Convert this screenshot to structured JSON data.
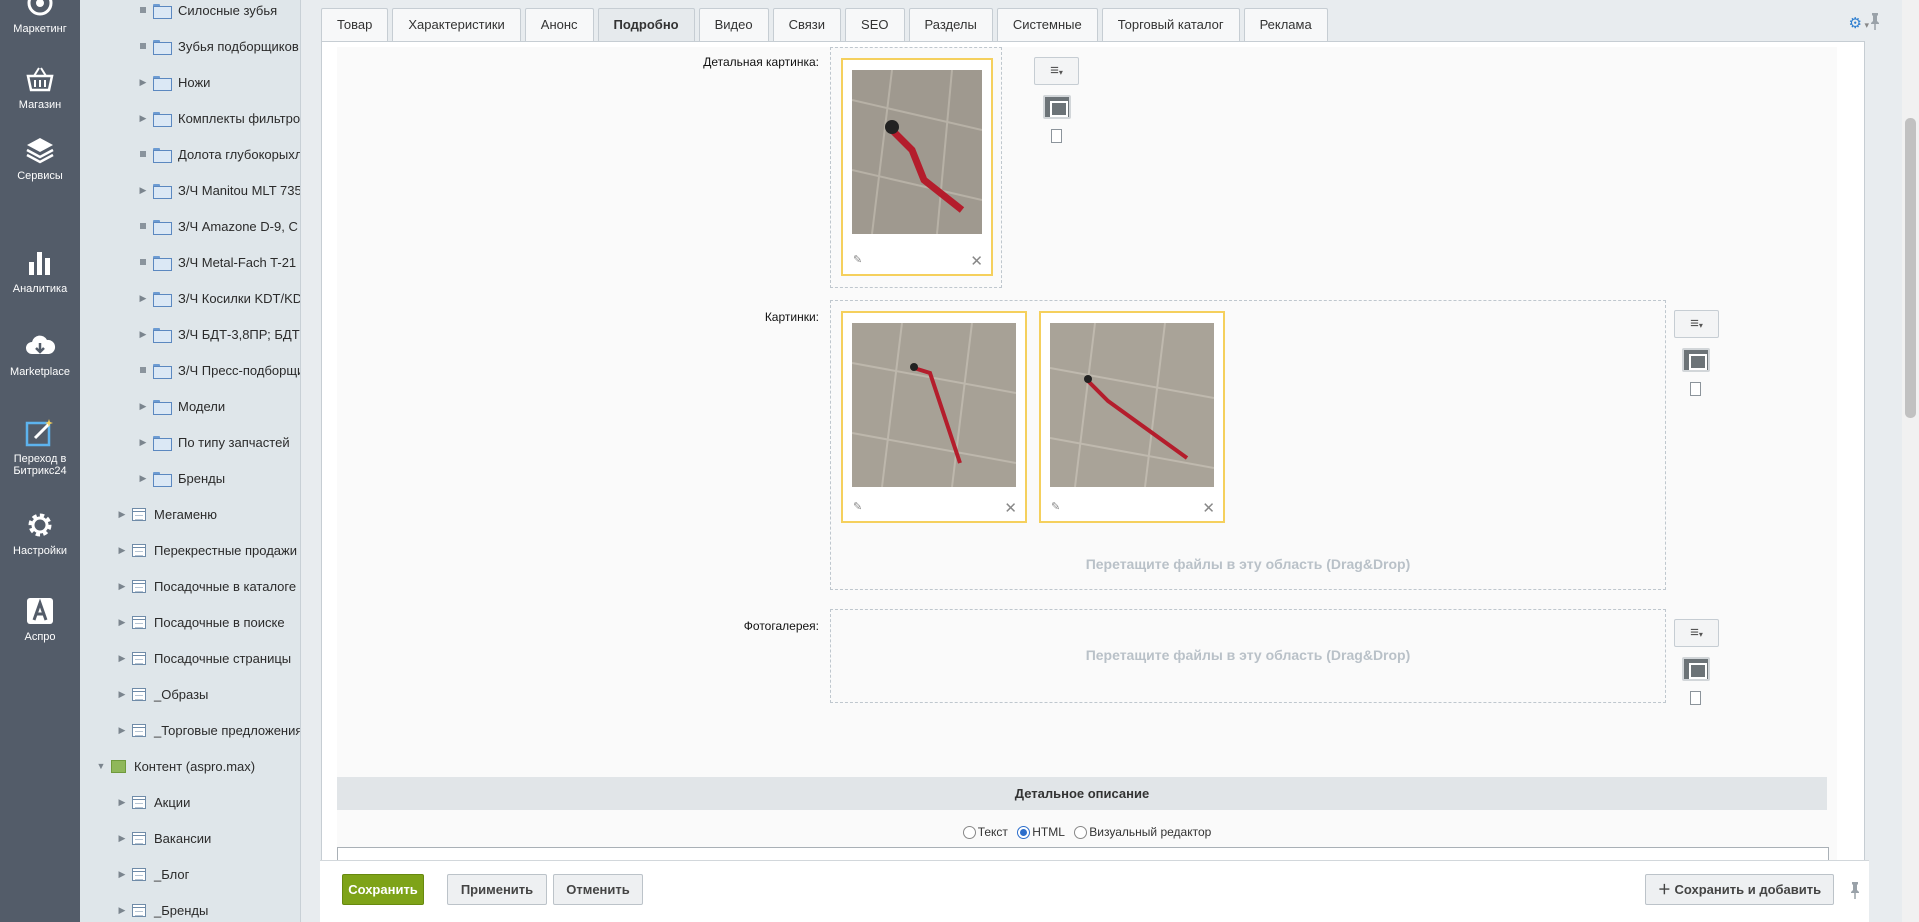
{
  "leftnav": [
    {
      "label": "Маркетинг",
      "icon": "marketing-icon"
    },
    {
      "label": "Магазин",
      "icon": "basket-icon"
    },
    {
      "label": "Сервисы",
      "icon": "layers-icon"
    },
    {
      "label": "Аналитика",
      "icon": "bar-chart-icon"
    },
    {
      "label": "Marketplace",
      "icon": "cloud-download-icon"
    },
    {
      "label": "Переход в Битрикс24",
      "icon": "magic-wand-icon"
    },
    {
      "label": "Настройки",
      "icon": "gear-icon"
    },
    {
      "label": "Аспро",
      "icon": "letter-a-icon"
    }
  ],
  "tree": {
    "folders": [
      "Силосные зубья",
      "Зубья подборщиков",
      "Ножи",
      "Комплекты фильтров",
      "Долота глубокорыхлителей",
      "З/Ч Manitou MLT 735",
      "З/Ч Amazone D-9, C",
      "З/Ч Metal-Fach T-21",
      "З/Ч Косилки KDT/KD",
      "З/Ч БДТ-3,8ПР; БДТ",
      "З/Ч Пресс-подборщик",
      "Модели",
      "По типу запчастей",
      "Бренды"
    ],
    "iblocks": [
      "Мегаменю",
      "Перекрестные продажи",
      "Посадочные в каталоге",
      "Посадочные в поиске",
      "Посадочные страницы",
      "_Образы",
      "_Торговые предложения"
    ],
    "content_type": "Контент (aspro.max)",
    "content_items": [
      "Акции",
      "Вакансии",
      "_Блог",
      "_Бренды"
    ]
  },
  "tabs": [
    "Товар",
    "Характеристики",
    "Анонс",
    "Подробно",
    "Видео",
    "Связи",
    "SEO",
    "Разделы",
    "Системные",
    "Торговый каталог",
    "Реклама"
  ],
  "active_tab": "Подробно",
  "form": {
    "detail_picture_label": "Детальная картинка:",
    "pictures_label": "Картинки:",
    "gallery_label": "Фотогалерея:",
    "drop_hint": "Перетащите файлы в эту область (Drag&Drop)",
    "detail_section": "Детальное описание",
    "radio_text": "Текст",
    "radio_html": "HTML",
    "radio_visual": "Визуальный редактор",
    "selected_mode": "HTML"
  },
  "footer": {
    "save": "Сохранить",
    "apply": "Применить",
    "cancel": "Отменить",
    "save_add": "Сохранить и добавить"
  },
  "colors": {
    "accent_green": "#7ea318",
    "nav_bg": "#535c69",
    "thumb_border": "#f5d05d"
  }
}
